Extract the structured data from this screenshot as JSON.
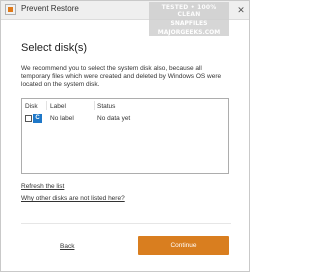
{
  "window": {
    "title": "Prevent Restore",
    "close_glyph": "✕",
    "watermark": {
      "line1": "TESTED • 100% CLEAN",
      "line2": "SNAPFILES",
      "line3": "MAJORGEEKS.COM"
    }
  },
  "main": {
    "heading": "Select disk(s)",
    "description": "We recommend you to select the system disk also, because all temporary files which were created and deleted by Windows OS were located on the system disk."
  },
  "disk_table": {
    "columns": [
      "Disk",
      "Label",
      "Status"
    ],
    "rows": [
      {
        "disk": "C",
        "label": "No label",
        "status": "No data yet",
        "checked": false
      }
    ]
  },
  "links": {
    "refresh": "Refresh the list",
    "other_disks": "Why other disks are not listed here?"
  },
  "footer": {
    "back": "Back",
    "continue": "Continue"
  },
  "colors": {
    "accent": "#d97e1f",
    "disk_icon": "#1f78c8"
  }
}
